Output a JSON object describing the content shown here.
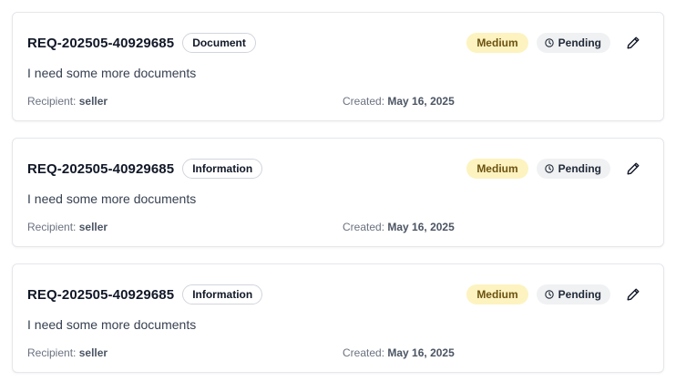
{
  "requests": [
    {
      "id": "REQ-202505-40929685",
      "type": "Document",
      "description": "I need some more documents",
      "recipient_label": "Recipient:",
      "recipient": "seller",
      "created_label": "Created:",
      "created": "May 16, 2025",
      "priority": "Medium",
      "status": "Pending",
      "status_icon": "clock-icon",
      "edit_icon": "pencil-icon"
    },
    {
      "id": "REQ-202505-40929685",
      "type": "Information",
      "description": "I need some more documents",
      "recipient_label": "Recipient:",
      "recipient": "seller",
      "created_label": "Created:",
      "created": "May 16, 2025",
      "priority": "Medium",
      "status": "Pending",
      "status_icon": "clock-icon",
      "edit_icon": "pencil-icon"
    },
    {
      "id": "REQ-202505-40929685",
      "type": "Information",
      "description": "I need some more documents",
      "recipient_label": "Recipient:",
      "recipient": "seller",
      "created_label": "Created:",
      "created": "May 16, 2025",
      "priority": "Medium",
      "status": "Pending",
      "status_icon": "clock-icon",
      "edit_icon": "pencil-icon"
    }
  ],
  "colors": {
    "priority_medium_bg": "#fdf3c0",
    "priority_medium_text": "#6b5210",
    "status_pending_bg": "#f0f1f3",
    "card_border": "#e5e7eb"
  }
}
